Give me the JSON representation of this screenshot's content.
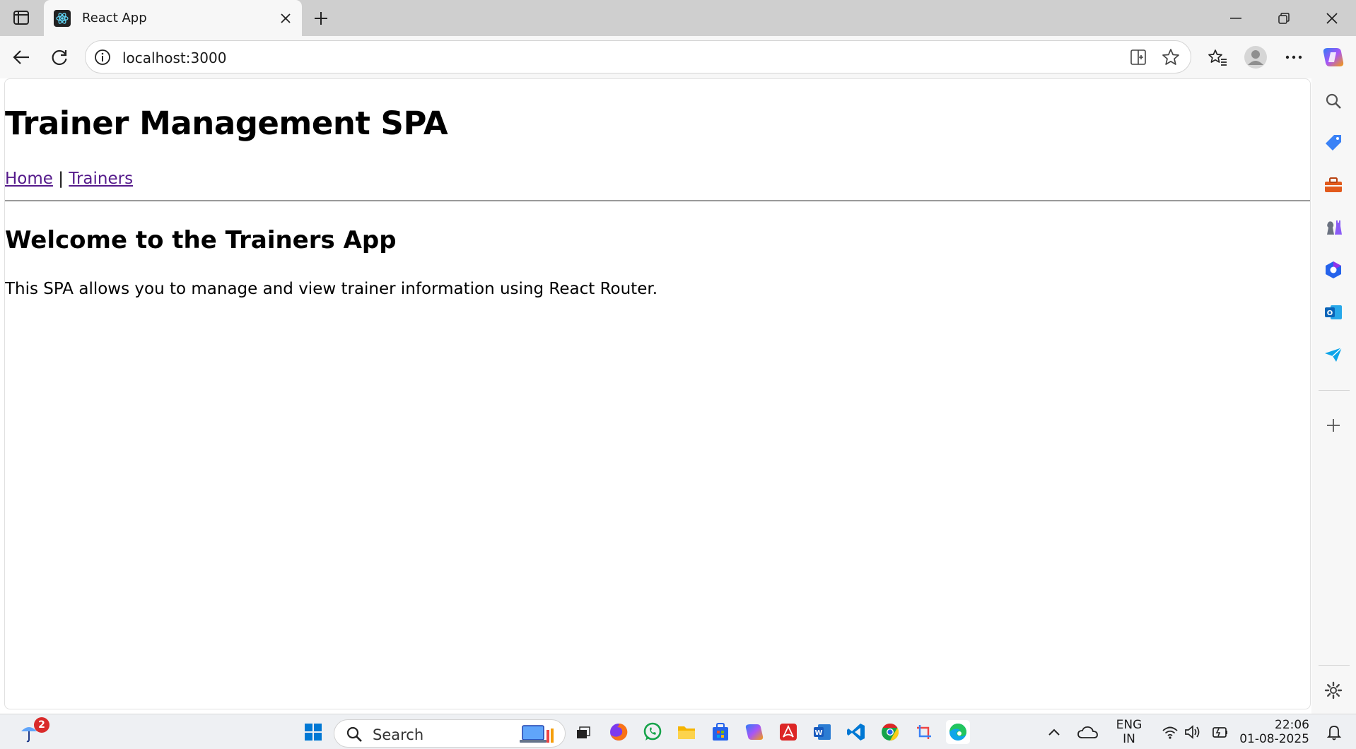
{
  "browser": {
    "tab": {
      "title": "React App"
    },
    "url": "localhost:3000"
  },
  "page": {
    "heading": "Trainer Management SPA",
    "nav": {
      "home": "Home",
      "separator": "|",
      "trainers": "Trainers"
    },
    "welcome_heading": "Welcome to the Trainers App",
    "description": "This SPA allows you to manage and view trainer information using React Router."
  },
  "taskbar": {
    "weather_badge": "2",
    "search_label": "Search",
    "language_line1": "ENG",
    "language_line2": "IN",
    "time": "22:06",
    "date": "01-08-2025"
  },
  "colors": {
    "link_visited": "#551a8b",
    "tabstrip": "#cfcfcf",
    "toolbar": "#f7f7f7",
    "taskbar": "#eef0f3",
    "windows_blue": "#0078d4"
  },
  "icons": {
    "tab_actions": "tab-actions-icon",
    "favicon": "react-logo-icon",
    "close": "close-icon",
    "new_tab": "plus-icon",
    "back": "back-arrow-icon",
    "refresh": "refresh-icon",
    "site_info": "info-icon",
    "split_screen": "split-screen-icon",
    "favorite": "star-icon",
    "favorites": "favorites-icon",
    "profile": "profile-icon",
    "more": "more-icon",
    "copilot": "copilot-icon"
  }
}
